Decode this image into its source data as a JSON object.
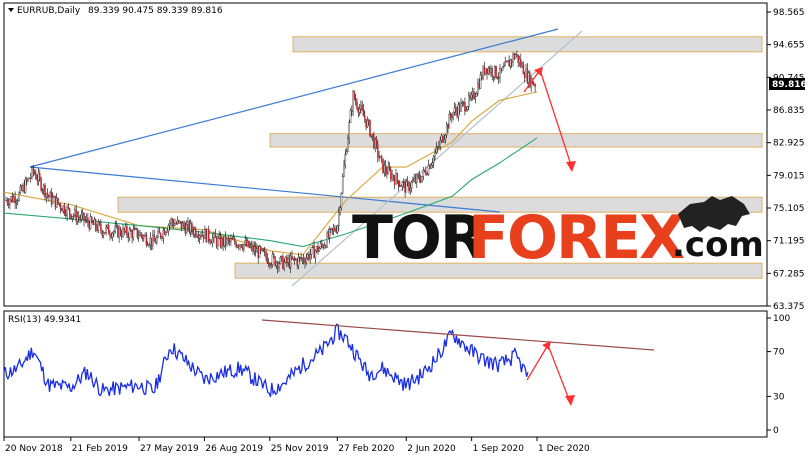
{
  "header": {
    "symbol": "EURRUB,Daily",
    "ohlc": "89.339 90.475 89.339 89.816"
  },
  "rsi_label": "RSI(13) 49.9341",
  "brand": {
    "part1": "TOR",
    "part2": "FOREX",
    "part3": ".com"
  },
  "current_price_tag": "89.816",
  "colors": {
    "candle_up": "#e8e8e8",
    "candle_down": "#c0272d",
    "ma_slow": "#2aa876",
    "ma_fast": "#d9a43a",
    "trend_line": "#3a7bd5",
    "rsi_line": "#1a2ee0",
    "rsi_trend": "#9a4a4a",
    "forecast_arrow": "#ff3030",
    "zone_fill": "#d8d8d8",
    "zone_border": "#e0b060",
    "price_tag_bg": "#000000"
  },
  "chart_data": [
    {
      "type": "candlestick",
      "title": "",
      "x_labels": [
        "20 Nov 2018",
        "21 Feb 2019",
        "27 May 2019",
        "26 Aug 2019",
        "25 Nov 2019",
        "27 Feb 2020",
        "2 Jun 2020",
        "1 Sep 2020",
        "1 Dec 2020"
      ],
      "y_ticks": [
        "98.565",
        "94.655",
        "90.745",
        "86.835",
        "82.925",
        "79.015",
        "75.105",
        "71.195",
        "67.285",
        "63.375"
      ],
      "ylim": [
        63.375,
        98.565
      ],
      "series": [
        {
          "name": "",
          "points": [
            [
              "20 Nov 2018",
              76.0
            ],
            [
              "10 Dec 2018",
              76.5
            ],
            [
              "31 Dec 2018",
              79.5
            ],
            [
              "21 Jan 2019",
              76.5
            ],
            [
              "21 Feb 2019",
              74.5
            ],
            [
              "15 Mar 2019",
              73.5
            ],
            [
              "5 Apr 2019",
              72.5
            ],
            [
              "27 May 2019",
              72.0
            ],
            [
              "17 Jun 2019",
              71.0
            ],
            [
              "10 Jul 2019",
              73.5
            ],
            [
              "26 Aug 2019",
              72.0
            ],
            [
              "16 Sep 2019",
              71.0
            ],
            [
              "15 Oct 2019",
              71.0
            ],
            [
              "25 Nov 2019",
              69.0
            ],
            [
              "15 Dec 2019",
              68.5
            ],
            [
              "10 Jan 2020",
              69.0
            ],
            [
              "5 Feb 2020",
              70.5
            ],
            [
              "27 Feb 2020",
              73.0
            ],
            [
              "10 Mar 2020",
              82.0
            ],
            [
              "20 Mar 2020",
              88.5
            ],
            [
              "10 Apr 2020",
              85.0
            ],
            [
              "30 Apr 2020",
              80.0
            ],
            [
              "2 Jun 2020",
              77.5
            ],
            [
              "25 Jun 2020",
              79.0
            ],
            [
              "15 Jul 2020",
              82.0
            ],
            [
              "5 Aug 2020",
              86.5
            ],
            [
              "1 Sep 2020",
              88.0
            ],
            [
              "20 Sep 2020",
              92.0
            ],
            [
              "10 Oct 2020",
              91.0
            ],
            [
              "1 Nov 2020",
              93.5
            ],
            [
              "20 Nov 2020",
              90.5
            ],
            [
              "1 Dec 2020",
              89.816
            ]
          ]
        }
      ],
      "moving_averages": [
        {
          "name": "",
          "color": "ma_fast",
          "points": [
            [
              "20 Nov 2018",
              77.0
            ],
            [
              "21 Feb 2019",
              75.5
            ],
            [
              "27 May 2019",
              73.0
            ],
            [
              "26 Aug 2019",
              72.5
            ],
            [
              "25 Nov 2019",
              70.0
            ],
            [
              "10 Jan 2020",
              69.5
            ],
            [
              "10 Mar 2020",
              76.0
            ],
            [
              "30 Apr 2020",
              80.0
            ],
            [
              "2 Jun 2020",
              80.0
            ],
            [
              "5 Aug 2020",
              83.0
            ],
            [
              "1 Sep 2020",
              85.5
            ],
            [
              "10 Oct 2020",
              88.0
            ],
            [
              "1 Dec 2020",
              89.0
            ]
          ]
        },
        {
          "name": "",
          "color": "ma_slow",
          "points": [
            [
              "20 Nov 2018",
              74.5
            ],
            [
              "21 Feb 2019",
              73.8
            ],
            [
              "27 May 2019",
              73.0
            ],
            [
              "26 Aug 2019",
              72.2
            ],
            [
              "25 Nov 2019",
              71.2
            ],
            [
              "10 Jan 2020",
              70.5
            ],
            [
              "10 Mar 2020",
              72.0
            ],
            [
              "2 Jun 2020",
              74.5
            ],
            [
              "5 Aug 2020",
              76.5
            ],
            [
              "1 Sep 2020",
              78.5
            ],
            [
              "10 Oct 2020",
              80.5
            ],
            [
              "1 Dec 2020",
              83.5
            ]
          ]
        }
      ],
      "support_resistance_zones": [
        {
          "from": 93.8,
          "to": 95.6
        },
        {
          "from": 82.4,
          "to": 84.0
        },
        {
          "from": 74.6,
          "to": 76.4
        },
        {
          "from": 66.7,
          "to": 68.5
        }
      ],
      "annotations": "trend lines, up-channel, forecast arrow up then down"
    },
    {
      "type": "line",
      "title": "",
      "name": "RSI(13)",
      "y_ticks": [
        "100",
        "70",
        "30",
        "0"
      ],
      "ylim": [
        0,
        100
      ],
      "points": [
        [
          "20 Nov 2018",
          50
        ],
        [
          "10 Dec 2018",
          55
        ],
        [
          "31 Dec 2018",
          72
        ],
        [
          "21 Jan 2019",
          40
        ],
        [
          "21 Feb 2019",
          38
        ],
        [
          "15 Mar 2019",
          52
        ],
        [
          "5 Apr 2019",
          35
        ],
        [
          "27 May 2019",
          40
        ],
        [
          "17 Jun 2019",
          35
        ],
        [
          "10 Jul 2019",
          75
        ],
        [
          "26 Aug 2019",
          45
        ],
        [
          "16 Sep 2019",
          50
        ],
        [
          "15 Oct 2019",
          55
        ],
        [
          "25 Nov 2019",
          35
        ],
        [
          "15 Dec 2019",
          42
        ],
        [
          "10 Jan 2020",
          58
        ],
        [
          "5 Feb 2020",
          70
        ],
        [
          "27 Feb 2020",
          88
        ],
        [
          "10 Mar 2020",
          82
        ],
        [
          "20 Mar 2020",
          72
        ],
        [
          "10 Apr 2020",
          50
        ],
        [
          "30 Apr 2020",
          55
        ],
        [
          "2 Jun 2020",
          40
        ],
        [
          "25 Jun 2020",
          50
        ],
        [
          "15 Jul 2020",
          65
        ],
        [
          "5 Aug 2020",
          86
        ],
        [
          "1 Sep 2020",
          70
        ],
        [
          "20 Sep 2020",
          62
        ],
        [
          "10 Oct 2020",
          58
        ],
        [
          "1 Nov 2020",
          66
        ],
        [
          "20 Nov 2020",
          46
        ],
        [
          "1 Dec 2020",
          49.9341
        ]
      ]
    }
  ]
}
